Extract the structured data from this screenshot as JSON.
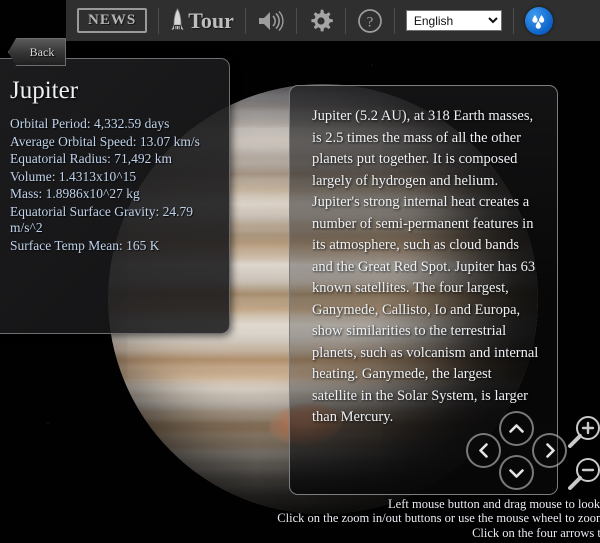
{
  "toolbar": {
    "back_label": "Back",
    "news_label": "NEWS",
    "tour_label": "Tour",
    "sound_icon": "speaker-icon",
    "settings_icon": "gear-icon",
    "help_icon": "question-mark-icon",
    "language_selected": "English",
    "language_options": [
      "English"
    ],
    "logo_icon": "water-droplets-logo-icon"
  },
  "info_panel": {
    "title": "Jupiter",
    "facts": [
      "Orbital Period: 4,332.59 days",
      "Average Orbital Speed: 13.07 km/s",
      "Equatorial Radius: 71,492 km",
      "Volume: 1.4313x10^15",
      "Mass: 1.8986x10^27 kg",
      "Equatorial Surface Gravity: 24.79 m/s^2",
      "Surface Temp Mean: 165 K"
    ]
  },
  "description_panel": {
    "text": "Jupiter (5.2 AU), at 318 Earth masses, is 2.5 times the mass of all the other planets put together. It is composed largely of hydrogen and helium. Jupiter's strong internal heat creates a number of semi-permanent features in its atmosphere, such as cloud bands and the Great Red Spot. Jupiter has 63 known satellites. The four largest, Ganymede, Callisto, Io and Europa, show similarities to the terrestrial planets, such as volcanism and internal heating. Ganymede, the largest satellite in the Solar System, is larger than Mercury."
  },
  "nav_controls": {
    "up_icon": "chevron-up-icon",
    "down_icon": "chevron-down-icon",
    "left_icon": "chevron-left-icon",
    "right_icon": "chevron-right-icon",
    "zoom_in_icon": "magnifier-plus-icon",
    "zoom_out_icon": "magnifier-minus-icon"
  },
  "help_text": {
    "line1": "Left mouse button and drag mouse to look around",
    "line2": "Click on the zoom in/out buttons or use the mouse wheel to zoom in/out",
    "line3": "Click on the four arrows to move"
  },
  "scene": {
    "object_name": "Jupiter",
    "feature": "Great Red Spot"
  }
}
